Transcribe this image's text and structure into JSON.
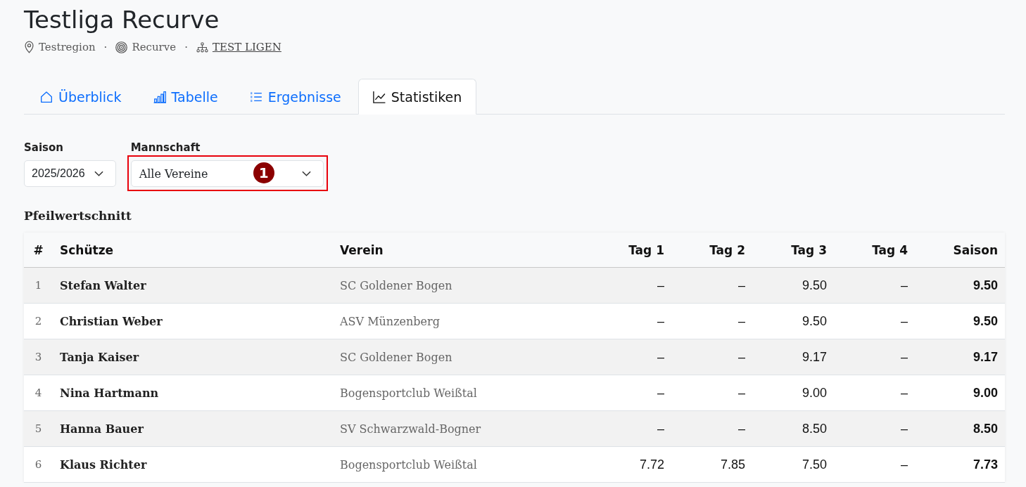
{
  "header": {
    "title": "Testliga Recurve",
    "meta": [
      {
        "kind": "place",
        "text": "Testregion"
      },
      {
        "kind": "separator",
        "text": "·"
      },
      {
        "kind": "discipline",
        "text": "Recurve"
      },
      {
        "kind": "separator",
        "text": "·"
      },
      {
        "kind": "league",
        "text": "TEST LIGEN"
      }
    ]
  },
  "tabs": [
    {
      "kind": "overview",
      "label": "Überblick",
      "selected": false
    },
    {
      "kind": "standings",
      "label": "Tabelle",
      "selected": false
    },
    {
      "kind": "results",
      "label": "Ergebnisse",
      "selected": false
    },
    {
      "kind": "statistics",
      "label": "Statistiken",
      "selected": true
    }
  ],
  "filters": [
    {
      "label": "Saison",
      "value": "2025/2026",
      "highlighted": false
    },
    {
      "label": "Mannschaft",
      "value": "Alle Vereine",
      "highlighted": true,
      "callout": "1"
    }
  ],
  "section_title": "Pfeilwertschnitt",
  "table": {
    "columns": [
      "#",
      "Schütze",
      "Verein",
      "Tag 1",
      "Tag 2",
      "Tag 3",
      "Tag 4",
      "Saison"
    ],
    "rows": [
      {
        "rank": "1",
        "name": "Stefan Walter",
        "club": "SC Goldener Bogen",
        "days": [
          "–",
          "–",
          "9.50",
          "–"
        ],
        "season": "9.50"
      },
      {
        "rank": "2",
        "name": "Christian Weber",
        "club": "ASV Münzenberg",
        "days": [
          "–",
          "–",
          "9.50",
          "–"
        ],
        "season": "9.50"
      },
      {
        "rank": "3",
        "name": "Tanja Kaiser",
        "club": "SC Goldener Bogen",
        "days": [
          "–",
          "–",
          "9.17",
          "–"
        ],
        "season": "9.17"
      },
      {
        "rank": "4",
        "name": "Nina Hartmann",
        "club": "Bogensportclub Weißtal",
        "days": [
          "–",
          "–",
          "9.00",
          "–"
        ],
        "season": "9.00"
      },
      {
        "rank": "5",
        "name": "Hanna Bauer",
        "club": "SV Schwarzwald-Bogner",
        "days": [
          "–",
          "–",
          "8.50",
          "–"
        ],
        "season": "8.50"
      },
      {
        "rank": "6",
        "name": "Klaus Richter",
        "club": "Bogensportclub Weißtal",
        "days": [
          "7.72",
          "7.85",
          "7.50",
          "–"
        ],
        "season": "7.73"
      }
    ]
  }
}
